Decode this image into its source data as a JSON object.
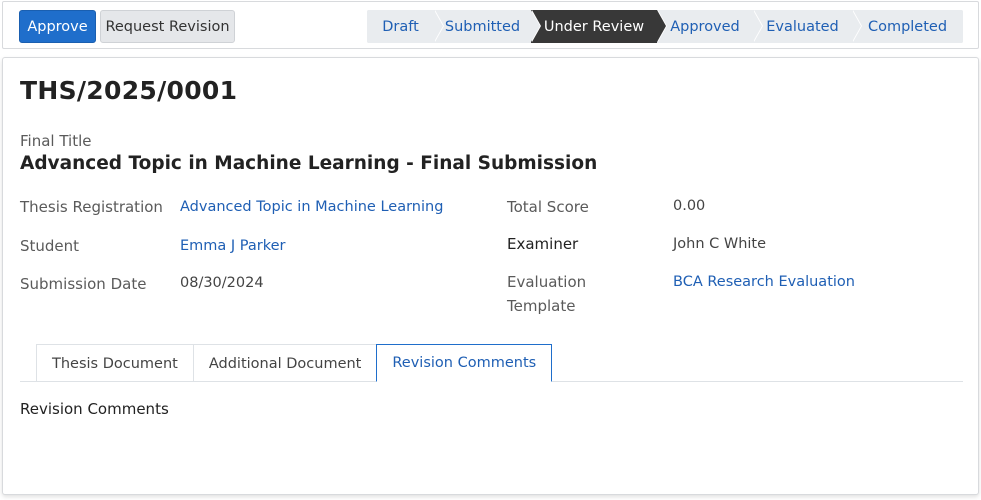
{
  "actions": {
    "approve_label": "Approve",
    "revision_label": "Request Revision"
  },
  "stages": [
    {
      "label": "Draft",
      "active": false
    },
    {
      "label": "Submitted",
      "active": false
    },
    {
      "label": "Under Review",
      "active": true
    },
    {
      "label": "Approved",
      "active": false
    },
    {
      "label": "Evaluated",
      "active": false
    },
    {
      "label": "Completed",
      "active": false
    }
  ],
  "record": {
    "reference": "THS/2025/0001",
    "final_title_label": "Final Title",
    "final_title": "Advanced Topic in Machine Learning - Final Submission",
    "thesis_registration_label": "Thesis Registration",
    "thesis_registration": "Advanced Topic in Machine Learning",
    "student_label": "Student",
    "student": "Emma J Parker",
    "submission_date_label": "Submission Date",
    "submission_date": "08/30/2024",
    "total_score_label": "Total Score",
    "total_score": "0.00",
    "examiner_label": "Examiner",
    "examiner": "John C White",
    "evaluation_template_label": "Evaluation Template",
    "evaluation_template": "BCA Research Evaluation"
  },
  "tabs": [
    {
      "label": "Thesis Document",
      "active": false
    },
    {
      "label": "Additional Document",
      "active": false
    },
    {
      "label": "Revision Comments",
      "active": true
    }
  ],
  "section": {
    "title": "Revision Comments"
  },
  "colors": {
    "primary": "#1f6ecb",
    "link": "#1f5fb4",
    "active_stage": "#383838"
  }
}
